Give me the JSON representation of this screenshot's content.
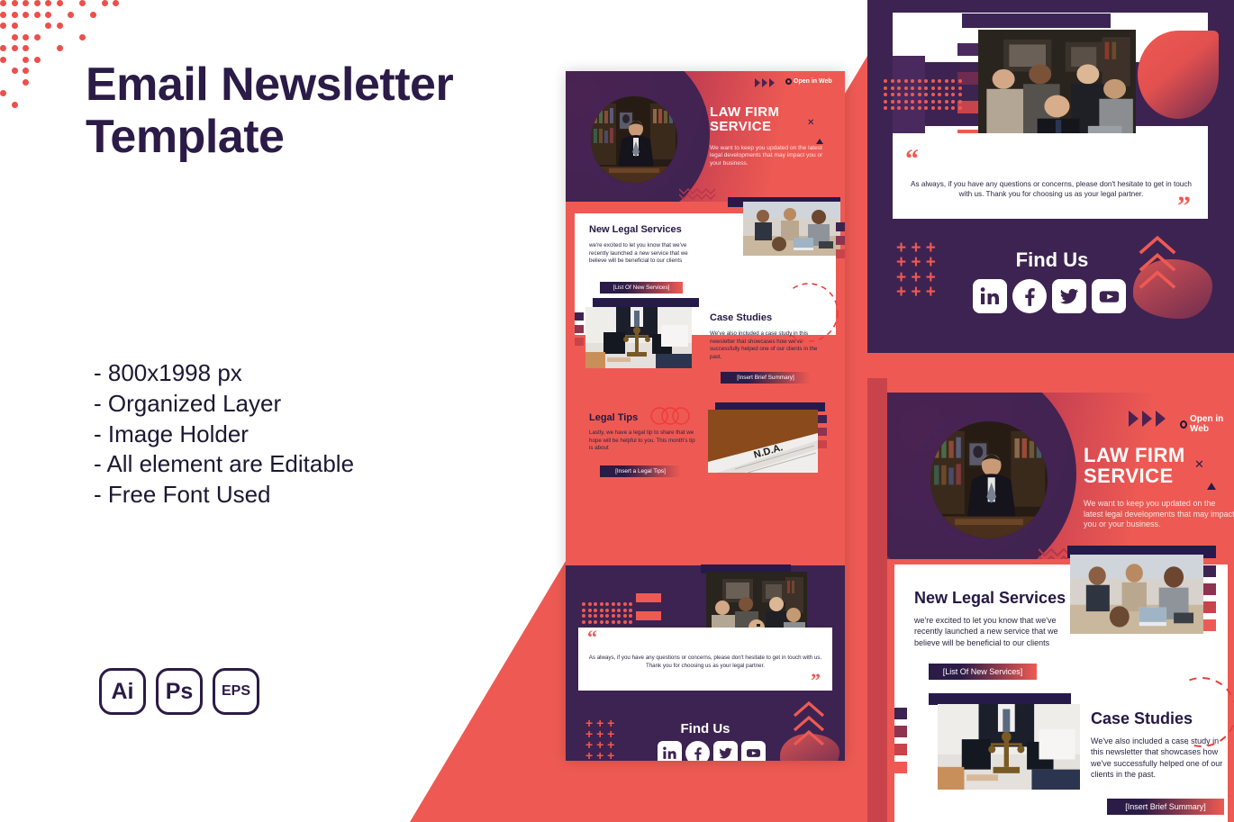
{
  "page": {
    "headline_line1": "Email Newsletter",
    "headline_line2": "Template",
    "accent_red": "#EE5A53",
    "deep_purple": "#3D2351",
    "navy": "#261A4B",
    "headline_color": "#2B1B47"
  },
  "features": [
    "- 800x1998 px",
    "- Organized Layer",
    "- Image Holder",
    "- All element are Editable",
    "- Free Font Used"
  ],
  "formats": [
    {
      "label": "Ai"
    },
    {
      "label": "Ps"
    },
    {
      "label": "EPS"
    }
  ],
  "newsletter": {
    "open_in_web": "Open in Web",
    "hero": {
      "title_line1": "LAW FIRM",
      "title_line2": "SERVICE",
      "subtitle": "We want to keep you updated on the latest legal developments that may impact you or your business."
    },
    "sections": [
      {
        "title": "New Legal Services",
        "body": "we're excited to let you know that we've recently launched a new service that we believe will be beneficial to our clients",
        "cta": "[List Of New Services]"
      },
      {
        "title": "Case Studies",
        "body": "We've also included a case study in this newsletter that showcases how we've successfully helped one of our clients in the past.",
        "cta": "[Insert Brief Summary]"
      },
      {
        "title": "Legal Tips",
        "body": "Lastly, we have a legal tip to share that we hope will be helpful to you. This month's tip is about",
        "cta": "[Insert a Legal Tips]"
      }
    ],
    "quote": "As always, if you have any questions or concerns, please don't hesitate to get in touch with us. Thank you for choosing us as your legal partner.",
    "quote_open": "“",
    "quote_close": "”",
    "footer": {
      "find_us": "Find Us",
      "socials": [
        "linkedin",
        "facebook",
        "twitter",
        "youtube"
      ]
    }
  }
}
